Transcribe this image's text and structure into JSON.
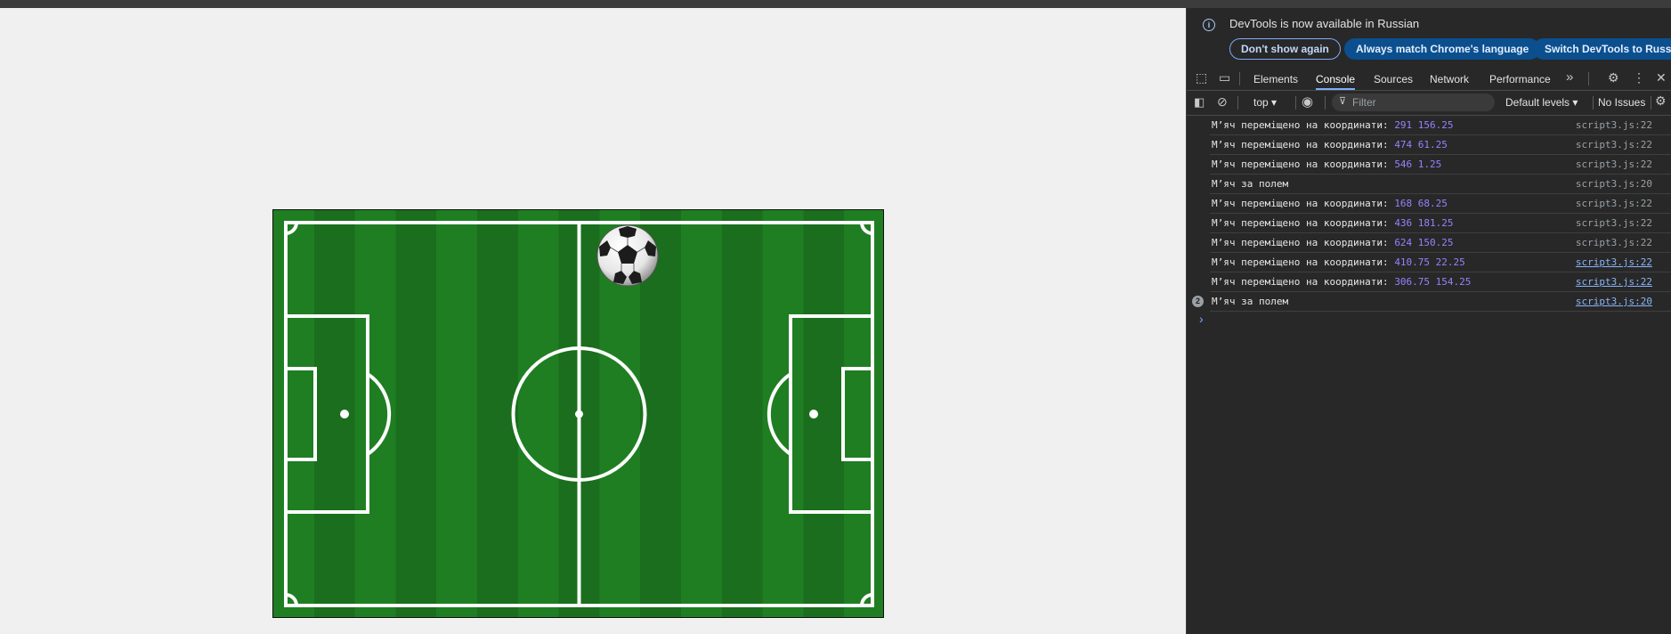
{
  "devtools": {
    "info_text": "DevTools is now available in Russian",
    "btn_dont_show": "Don't show again",
    "btn_always_match": "Always match Chrome's language",
    "btn_switch": "Switch DevTools to Russian",
    "tabs": [
      "Elements",
      "Console",
      "Sources",
      "Network",
      "Performance"
    ],
    "more_tabs": "»",
    "context": "top ▾",
    "filter_placeholder": "Filter",
    "levels": "Default levels ▾",
    "issues": "No Issues",
    "logs": [
      {
        "prefix": "М’яч переміщено на координати: ",
        "value": "291 156.25",
        "src": "script3.js:22",
        "link": false
      },
      {
        "prefix": "М’яч переміщено на координати: ",
        "value": "474 61.25",
        "src": "script3.js:22",
        "link": false
      },
      {
        "prefix": "М’яч переміщено на координати: ",
        "value": "546 1.25",
        "src": "script3.js:22",
        "link": false
      },
      {
        "prefix": "М’яч за полем",
        "value": "",
        "src": "script3.js:20",
        "link": false
      },
      {
        "prefix": "М’яч переміщено на координати: ",
        "value": "168 68.25",
        "src": "script3.js:22",
        "link": false
      },
      {
        "prefix": "М’яч переміщено на координати: ",
        "value": "436 181.25",
        "src": "script3.js:22",
        "link": false
      },
      {
        "prefix": "М’яч переміщено на координати: ",
        "value": "624 150.25",
        "src": "script3.js:22",
        "link": false
      },
      {
        "prefix": "М’яч переміщено на координати: ",
        "value": "410.75 22.25",
        "src": "script3.js:22",
        "link": true
      },
      {
        "prefix": "М’яч переміщено на координати: ",
        "value": "306.75 154.25",
        "src": "script3.js:22",
        "link": true
      },
      {
        "prefix": "М’яч за полем",
        "value": "",
        "src": "script3.js:20",
        "link": true,
        "count": "2"
      }
    ]
  }
}
